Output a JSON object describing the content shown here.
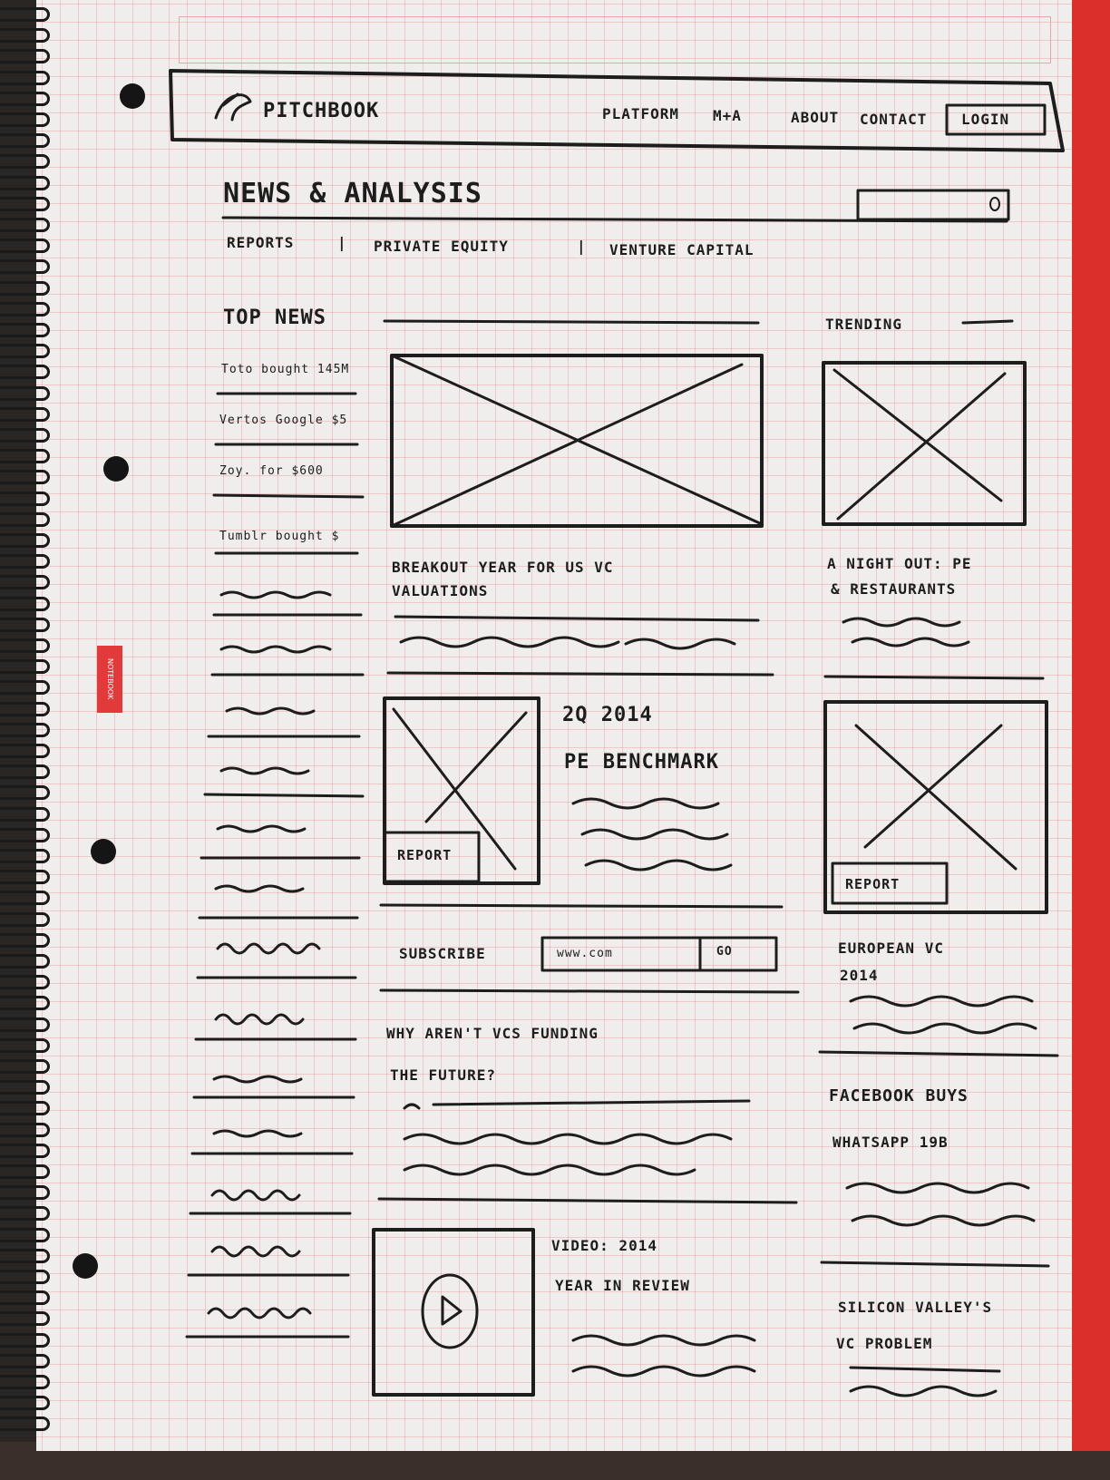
{
  "header": {
    "logo_text": "PITCHBOOK",
    "nav": [
      "PLATFORM",
      "M+A",
      "ABOUT",
      "CONTACT"
    ],
    "login_label": "LOGIN"
  },
  "page": {
    "title": "NEWS & ANALYSIS",
    "subnav": [
      "REPORTS",
      "|",
      "PRIVATE EQUITY",
      "|",
      "VENTURE CAPITAL"
    ]
  },
  "top_news": {
    "heading": "TOP NEWS",
    "items": [
      "Toto bought 145M",
      "Vertos Google $5",
      "Zoy. for $600",
      "Tumblr bought $"
    ]
  },
  "trending": {
    "heading": "TRENDING"
  },
  "articles": {
    "main_headline_1": "BREAKOUT YEAR FOR US VC",
    "main_headline_2": "VALUATIONS",
    "report_1_title_1": "2Q 2014",
    "report_1_title_2": "PE BENCHMARK",
    "report_badge": "REPORT",
    "why_1": "WHY AREN'T VCS FUNDING",
    "why_2": "THE FUTURE?",
    "video_1": "VIDEO: 2014",
    "video_2": "YEAR IN REVIEW"
  },
  "subscribe": {
    "label": "SUBSCRIBE",
    "placeholder": "www.com",
    "button": "GO"
  },
  "sidebar": {
    "night_1": "A NIGHT OUT: PE",
    "night_2": "& RESTAURANTS",
    "report_badge": "REPORT",
    "euro_1": "EUROPEAN VC",
    "euro_2": "2014",
    "fb_1": "FACEBOOK BUYS",
    "fb_2": "WHATSAPP 19B",
    "sv_1": "SILICON VALLEY'S",
    "sv_2": "VC PROBLEM"
  }
}
